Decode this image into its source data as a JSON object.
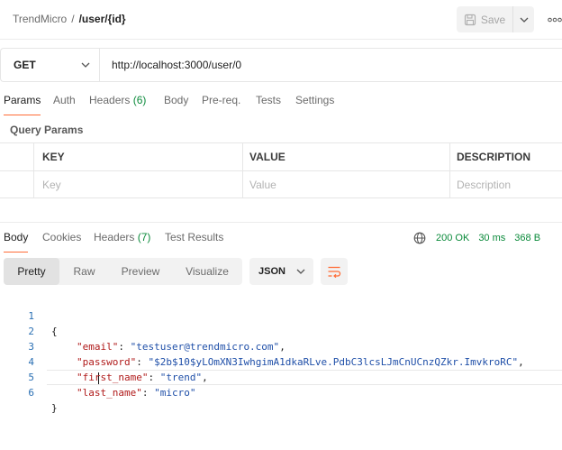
{
  "header": {
    "workspace": "TrendMicro",
    "separator": "/",
    "request_name": "/user/{id}",
    "save_label": "Save"
  },
  "request": {
    "method": "GET",
    "url": "http://localhost:3000/user/0"
  },
  "request_tabs": {
    "params": "Params",
    "auth": "Auth",
    "headers": "Headers",
    "headers_count": "(6)",
    "body": "Body",
    "prereq": "Pre-req.",
    "tests": "Tests",
    "settings": "Settings"
  },
  "query_params": {
    "title": "Query Params",
    "columns": {
      "key": "KEY",
      "value": "VALUE",
      "description": "DESCRIPTION"
    },
    "placeholders": {
      "key": "Key",
      "value": "Value",
      "description": "Description"
    }
  },
  "response_tabs": {
    "body": "Body",
    "cookies": "Cookies",
    "headers": "Headers",
    "headers_count": "(7)",
    "test_results": "Test Results"
  },
  "response_status": {
    "status": "200 OK",
    "time": "30 ms",
    "size": "368 B"
  },
  "view_modes": {
    "pretty": "Pretty",
    "raw": "Raw",
    "preview": "Preview",
    "visualize": "Visualize",
    "format": "JSON"
  },
  "code": {
    "line_numbers": [
      "1",
      "2",
      "3",
      "4",
      "5",
      "6"
    ],
    "open_brace": "{",
    "close_brace": "}",
    "fields": [
      {
        "key": "\"email\"",
        "value": "\"testuser@trendmicro.com\"",
        "trail": ","
      },
      {
        "key": "\"password\"",
        "value": "\"$2b$10$yLOmXN3IwhgimA1dkaRLve.PdbC3lcsLJmCnUCnzQZkr.ImvkroRC\"",
        "trail": ","
      },
      {
        "key": "\"first_name\"",
        "value": "\"trend\"",
        "trail": ","
      },
      {
        "key": "\"last_name\"",
        "value": "\"micro\"",
        "trail": ""
      }
    ]
  },
  "colors": {
    "accent": "#ff6c37",
    "success": "#0a8a3a",
    "json_key": "#b01a1a",
    "json_string": "#1f4fa8"
  }
}
